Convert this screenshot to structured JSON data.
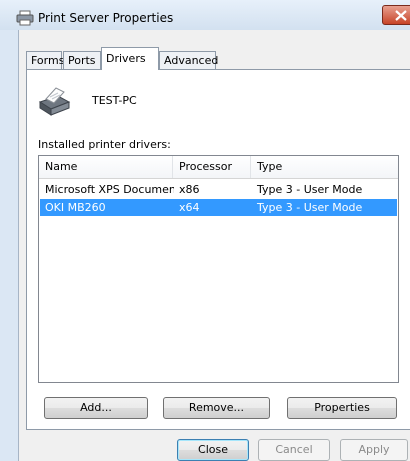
{
  "window": {
    "title": "Print Server Properties"
  },
  "tabs": [
    {
      "label": "Forms"
    },
    {
      "label": "Ports"
    },
    {
      "label": "Drivers"
    },
    {
      "label": "Advanced"
    }
  ],
  "active_tab": "Drivers",
  "server": {
    "name": "TEST-PC"
  },
  "drivers": {
    "label": "Installed printer drivers:",
    "columns": [
      "Name",
      "Processor",
      "Type"
    ],
    "rows": [
      {
        "name": "Microsoft XPS Documen…",
        "processor": "x86",
        "type": "Type 3 - User Mode",
        "selected": false
      },
      {
        "name": "OKI MB260",
        "processor": "x64",
        "type": "Type 3 - User Mode",
        "selected": true
      }
    ]
  },
  "buttons": {
    "add": "Add...",
    "remove": "Remove...",
    "properties": "Properties",
    "close": "Close",
    "cancel": "Cancel",
    "apply": "Apply"
  },
  "colors": {
    "selection": "#3399ff",
    "close_button": "#c74428"
  }
}
